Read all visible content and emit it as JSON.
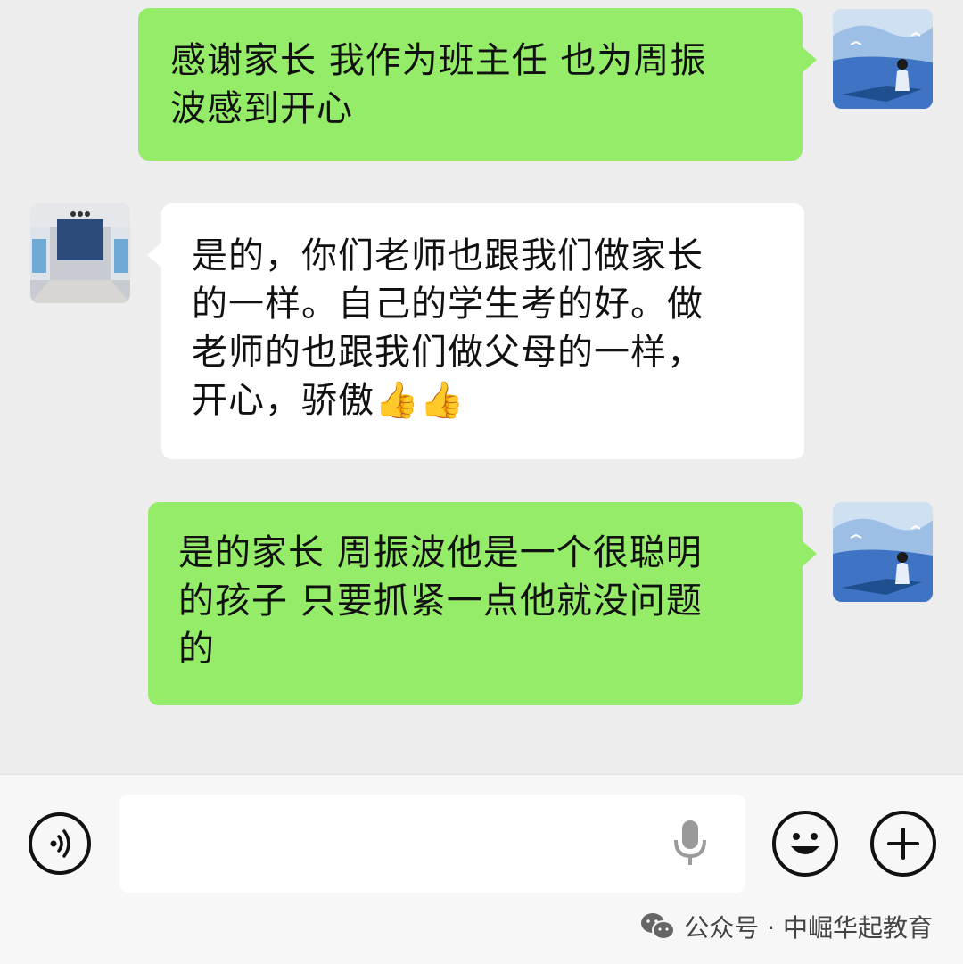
{
  "messages": [
    {
      "side": "out",
      "lines": [
        "感谢家长 我作为班主任 也为周振",
        "波感到开心"
      ],
      "avatar": "outgoing-avatar"
    },
    {
      "side": "in",
      "lines": [
        "是的，你们老师也跟我们做家长",
        "的一样。自己的学生考的好。做",
        "老师的也跟我们做父母的一样，",
        "开心，骄傲"
      ],
      "emoji": "👍👍",
      "avatar": "incoming-avatar"
    },
    {
      "side": "out",
      "lines": [
        "是的家长 周振波他是一个很聪明",
        "的孩子 只要抓紧一点他就没问题",
        "的"
      ],
      "avatar": "outgoing-avatar"
    }
  ],
  "input_bar": {
    "voice_icon": "voice-icon",
    "mic_icon": "microphone-icon",
    "emoji_icon": "emoji-icon",
    "plus_icon": "plus-icon",
    "text_value": "",
    "placeholder": ""
  },
  "watermark": {
    "icon": "wechat-icon",
    "text": "公众号 · 中崛华起教育"
  },
  "colors": {
    "background": "#ededed",
    "outgoing_bubble": "#95ec69",
    "incoming_bubble": "#ffffff",
    "input_bar": "#f7f7f7"
  }
}
